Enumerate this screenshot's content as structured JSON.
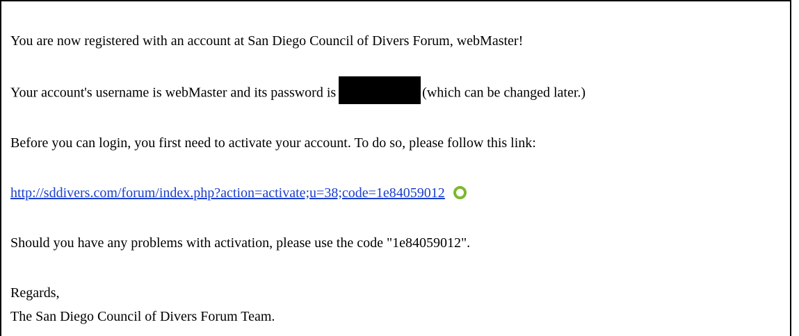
{
  "email": {
    "line1": "You are now registered with an account at San Diego Council of Divers Forum, webMaster!",
    "line2_before": "Your account's username is webMaster and its password is",
    "line2_after": "(which can be changed later.)",
    "line3": "Before you can login, you first need to activate your account. To do so, please follow this link:",
    "activation_link": "http://sddivers.com/forum/index.php?action=activate;u=38;code=1e84059012",
    "line5": "Should you have any problems with activation, please use the code \"1e84059012\".",
    "regards": "Regards,",
    "signature": "The San Diego Council of Divers Forum Team."
  },
  "colors": {
    "link": "#1a3ecc",
    "badge": "#7cb82f",
    "redaction": "#000000"
  },
  "icons": {
    "link_badge": "green-ring-icon"
  }
}
